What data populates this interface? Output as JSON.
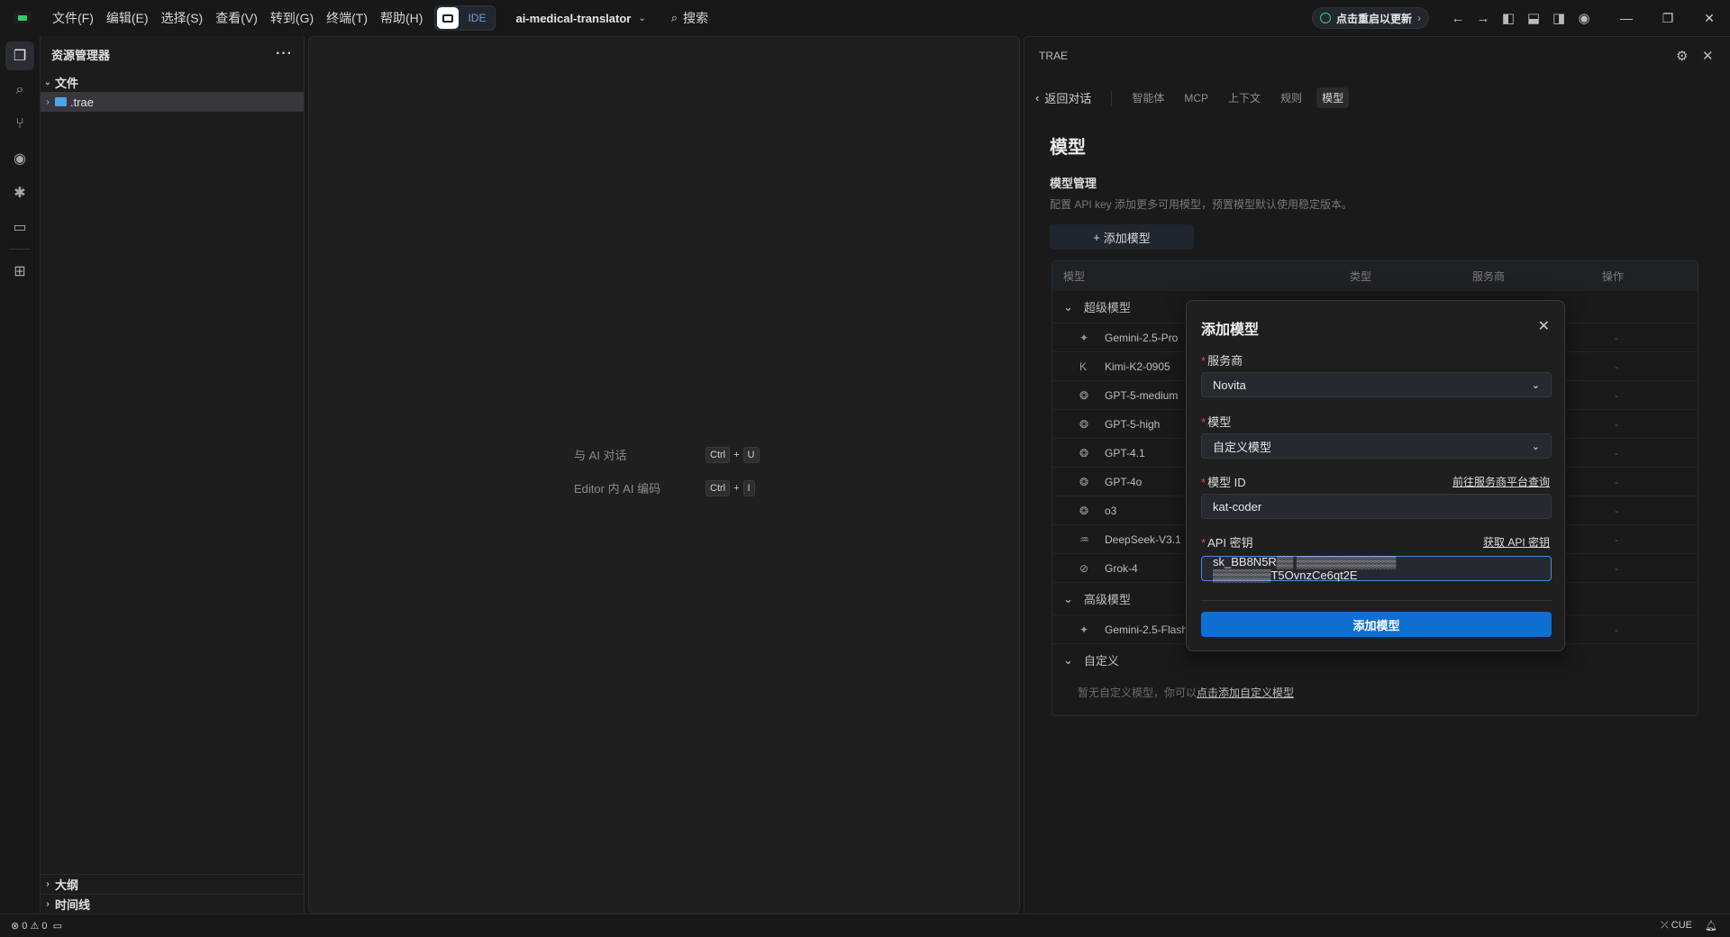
{
  "titlebar": {
    "menu": [
      "文件(F)",
      "编辑(E)",
      "选择(S)",
      "查看(V)",
      "转到(G)",
      "终端(T)",
      "帮助(H)"
    ],
    "ide_label": "IDE",
    "project_name": "ai-medical-translator",
    "search_label": "搜索",
    "update_label": "点击重启以更新"
  },
  "sidebar": {
    "title": "资源管理器",
    "section_files": "文件",
    "folder_trae": ".trae",
    "outline": "大纲",
    "timeline": "时间线"
  },
  "editor": {
    "hint_chat": "与 AI 对话",
    "hint_chat_keys": [
      "Ctrl",
      "U"
    ],
    "hint_code": "Editor 内 AI 编码",
    "hint_code_keys": [
      "Ctrl",
      "I"
    ]
  },
  "panel": {
    "title": "TRAE",
    "back": "返回对话",
    "tabs": [
      "智能体",
      "MCP",
      "上下文",
      "规则",
      "模型"
    ],
    "heading": "模型",
    "subheading": "模型管理",
    "description": "配置 API key 添加更多可用模型，预置模型默认使用稳定版本。",
    "add_button": "添加模型",
    "table_headers": [
      "模型",
      "类型",
      "服务商",
      "操作"
    ],
    "group_super": "超级模型",
    "super_models": [
      "Gemini-2.5-Pro",
      "Kimi-K2-0905",
      "GPT-5-medium",
      "GPT-5-high",
      "GPT-4.1",
      "GPT-4o",
      "o3",
      "DeepSeek-V3.1",
      "Grok-4"
    ],
    "group_advanced": "高级模型",
    "advanced_models": [
      "Gemini-2.5-Flash"
    ],
    "group_custom": "自定义",
    "custom_empty": "暂无自定义模型，你可以",
    "custom_link": "点击添加自定义模型",
    "dash": "-"
  },
  "modal": {
    "title": "添加模型",
    "provider_label": "服务商",
    "provider_value": "Novita",
    "model_label": "模型",
    "model_value": "自定义模型",
    "model_id_label": "模型 ID",
    "model_id_link": "前往服务商平台查询",
    "model_id_value": "kat-coder",
    "api_key_label": "API 密钥",
    "api_key_link": "获取 API 密钥",
    "api_key_value": "sk_BB8N5R▒▒ ▒▒▒▒▒▒▒▒▒▒▒▒ ▒▒▒▒▒▒▒T5OvnzCe6qt2E",
    "submit": "添加模型"
  },
  "status": {
    "errors": "0",
    "warnings": "0",
    "cue": "CUE"
  }
}
